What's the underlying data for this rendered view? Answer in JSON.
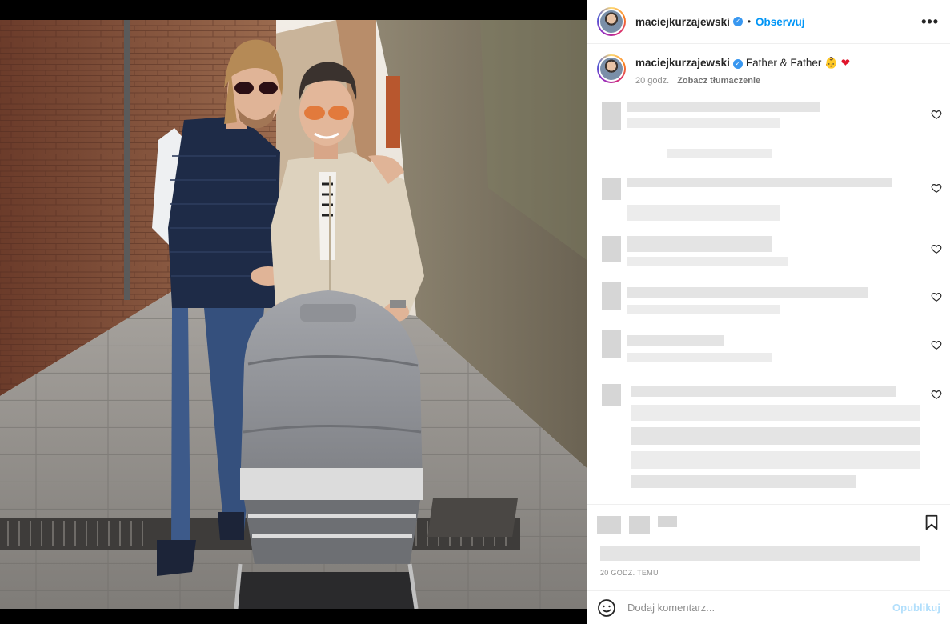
{
  "post": {
    "username": "maciejkurzajewski",
    "verified_icon": "verified-badge-icon",
    "separator": "•",
    "follow_label": "Obserwuj",
    "more_label": "•••"
  },
  "caption": {
    "username": "maciejkurzajewski",
    "text": "Father & Father",
    "emoji_1": "👶",
    "emoji_2": "❤",
    "age": "20 godz.",
    "translate_label": "Zobacz tłumaczenie"
  },
  "footer": {
    "time_ago": "20 GODZ. TEMU",
    "comment_placeholder": "Dodaj komentarz...",
    "publish_label": "Opublikuj"
  },
  "colors": {
    "accent": "#0095f6",
    "publish_disabled": "#b2dffc",
    "heart": "#e0152b"
  },
  "icons": [
    "verified-badge-icon",
    "more-options-icon",
    "heart-outline-icon",
    "bookmark-icon",
    "emoji-smiley-icon"
  ]
}
